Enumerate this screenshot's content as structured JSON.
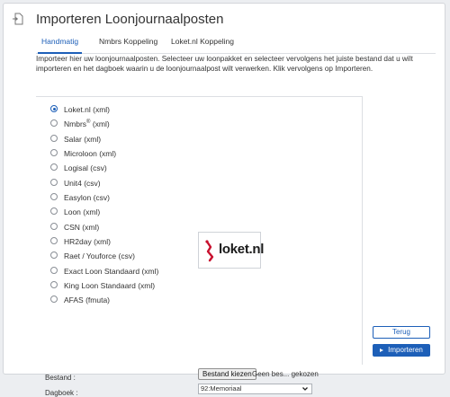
{
  "window": {
    "title": "Importeren Loonjournaalposten",
    "icon": "import-document-icon"
  },
  "tabs": [
    {
      "label": "Handmatig",
      "active": true
    },
    {
      "label": "Nmbrs Koppeling",
      "active": false
    },
    {
      "label": "Loket.nl Koppeling",
      "active": false
    }
  ],
  "intro": "Importeer hier uw loonjournaalposten. Selecteer uw loonpakket en selecteer vervolgens het juiste bestand dat u wilt importeren en het dagboek waarin u de loonjournaalpost wilt verwerken. Klik vervolgens op Importeren.",
  "options": [
    {
      "label": "Loket.nl (xml)",
      "checked": true
    },
    {
      "label": "Nmbrs",
      "sup": "®",
      "suffix": " (xml)",
      "checked": false
    },
    {
      "label": "Salar (xml)",
      "checked": false
    },
    {
      "label": "Microloon (xml)",
      "checked": false
    },
    {
      "label": "Logisal (csv)",
      "checked": false
    },
    {
      "label": "Unit4 (csv)",
      "checked": false
    },
    {
      "label": "Easylon (csv)",
      "checked": false
    },
    {
      "label": "Loon (xml)",
      "checked": false
    },
    {
      "label": "CSN (xml)",
      "checked": false
    },
    {
      "label": "HR2day (xml)",
      "checked": false
    },
    {
      "label": "Raet / Youforce (csv)",
      "checked": false
    },
    {
      "label": "Exact Loon Standaard (xml)",
      "checked": false
    },
    {
      "label": "King Loon Standaard (xml)",
      "checked": false
    },
    {
      "label": "AFAS (fmuta)",
      "checked": false
    }
  ],
  "logo": {
    "text": "loket.nl",
    "icon": "loket-logo-icon",
    "accent": "#c8102e"
  },
  "form": {
    "file_label": "Bestand :",
    "file_button": "Bestand kiezen",
    "file_status": "Geen bes... gekozen",
    "journal_label": "Dagboek :",
    "journal_value": "92:Memoriaal"
  },
  "buttons": {
    "back": "Terug",
    "import": "Importeren"
  },
  "colors": {
    "accent": "#1d5fb8",
    "background": "#eceef1"
  }
}
